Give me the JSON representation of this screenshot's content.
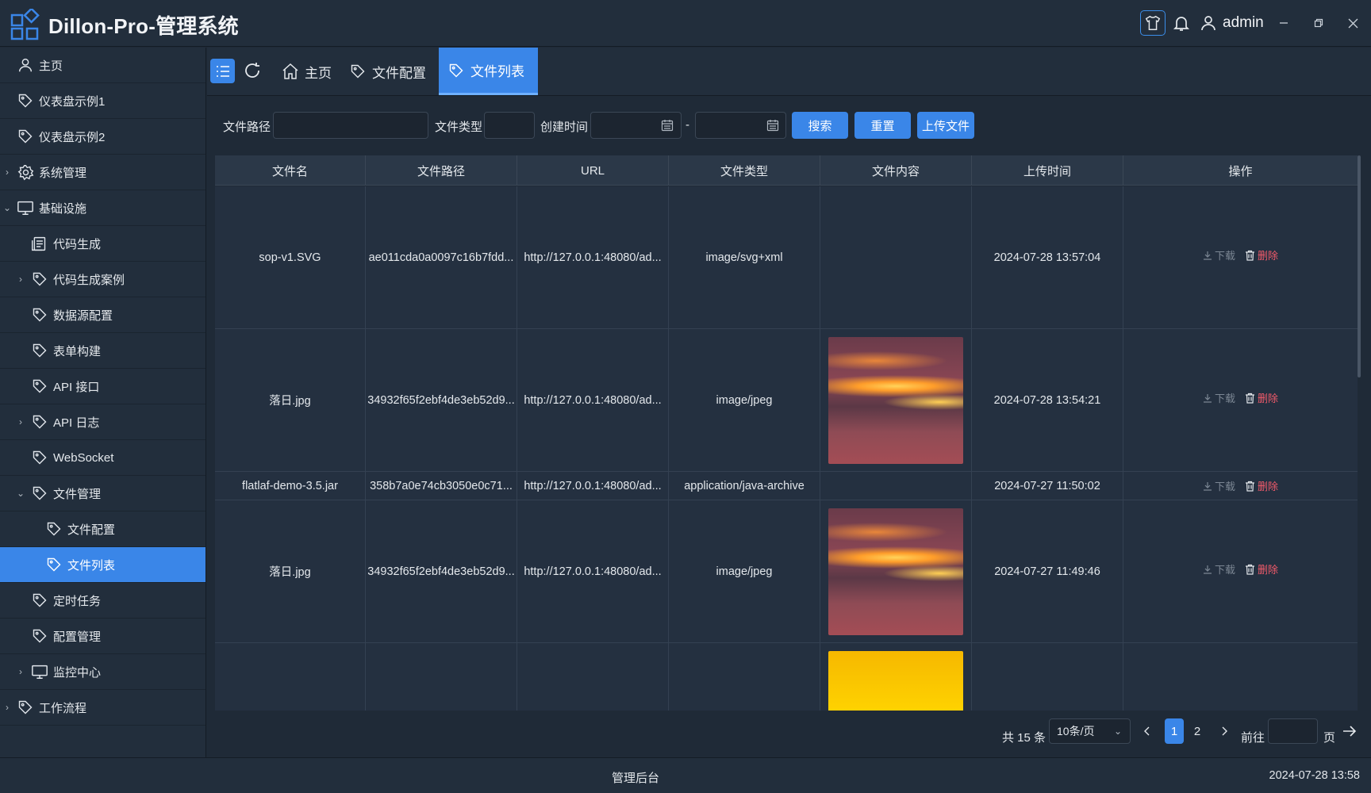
{
  "app": {
    "title": "Dillon-Pro-管理系统",
    "user": "admin"
  },
  "sidebar": {
    "items": [
      {
        "label": "主页",
        "icon": "user-icon"
      },
      {
        "label": "仪表盘示例1",
        "icon": "tag-icon"
      },
      {
        "label": "仪表盘示例2",
        "icon": "tag-icon"
      },
      {
        "label": "系统管理",
        "icon": "gear-icon"
      },
      {
        "label": "基础设施",
        "icon": "monitor-icon"
      },
      {
        "label": "代码生成",
        "icon": "document-icon"
      },
      {
        "label": "代码生成案例",
        "icon": "tag-icon"
      },
      {
        "label": "数据源配置",
        "icon": "tag-icon"
      },
      {
        "label": "表单构建",
        "icon": "tag-icon"
      },
      {
        "label": "API 接口",
        "icon": "tag-icon"
      },
      {
        "label": "API 日志",
        "icon": "tag-icon"
      },
      {
        "label": "WebSocket",
        "icon": "tag-icon"
      },
      {
        "label": "文件管理",
        "icon": "tag-icon"
      },
      {
        "label": "文件配置",
        "icon": "tag-icon"
      },
      {
        "label": "文件列表",
        "icon": "tag-icon"
      },
      {
        "label": "定时任务",
        "icon": "tag-icon"
      },
      {
        "label": "配置管理",
        "icon": "tag-icon"
      },
      {
        "label": "监控中心",
        "icon": "monitor-icon"
      },
      {
        "label": "工作流程",
        "icon": "tag-icon"
      }
    ]
  },
  "tabs": [
    {
      "label": "主页"
    },
    {
      "label": "文件配置"
    },
    {
      "label": "文件列表"
    }
  ],
  "search": {
    "path_label": "文件路径",
    "path_value": "",
    "type_label": "文件类型",
    "type_value": "",
    "created_label": "创建时间",
    "date_from": "",
    "date_to": "",
    "separator": "-",
    "search_btn": "搜索",
    "reset_btn": "重置",
    "upload_btn": "上传文件"
  },
  "table": {
    "columns": [
      "文件名",
      "文件路径",
      "URL",
      "文件类型",
      "文件内容",
      "上传时间",
      "操作"
    ],
    "download_label": "下载",
    "delete_label": "删除",
    "rows": [
      {
        "name": "sop-v1.SVG",
        "path": "ae011cda0a0097c16b7fdd...",
        "url": "http://127.0.0.1:48080/ad...",
        "type": "image/svg+xml",
        "content": "",
        "time": "2024-07-28 13:57:04"
      },
      {
        "name": "落日.jpg",
        "path": "34932f65f2ebf4de3eb52d9...",
        "url": "http://127.0.0.1:48080/ad...",
        "type": "image/jpeg",
        "content": "sunset",
        "time": "2024-07-28 13:54:21"
      },
      {
        "name": "flatlaf-demo-3.5.jar",
        "path": "358b7a0e74cb3050e0c71...",
        "url": "http://127.0.0.1:48080/ad...",
        "type": "application/java-archive",
        "content": "",
        "time": "2024-07-27 11:50:02"
      },
      {
        "name": "落日.jpg",
        "path": "34932f65f2ebf4de3eb52d9...",
        "url": "http://127.0.0.1:48080/ad...",
        "type": "image/jpeg",
        "content": "sunset",
        "time": "2024-07-27 11:49:46"
      },
      {
        "name": "",
        "path": "",
        "url": "",
        "type": "",
        "content": "yellow",
        "time": ""
      }
    ]
  },
  "pagination": {
    "total_text": "共 15 条",
    "page_size": "10条/页",
    "pages": [
      "1",
      "2"
    ],
    "current": "1",
    "goto_label": "前往",
    "page_suffix": "页"
  },
  "status": {
    "center": "管理后台",
    "time": "2024-07-28 13:58"
  },
  "colors": {
    "accent": "#3a86e8",
    "danger": "#f05a6a",
    "background": "#1f2a37"
  }
}
